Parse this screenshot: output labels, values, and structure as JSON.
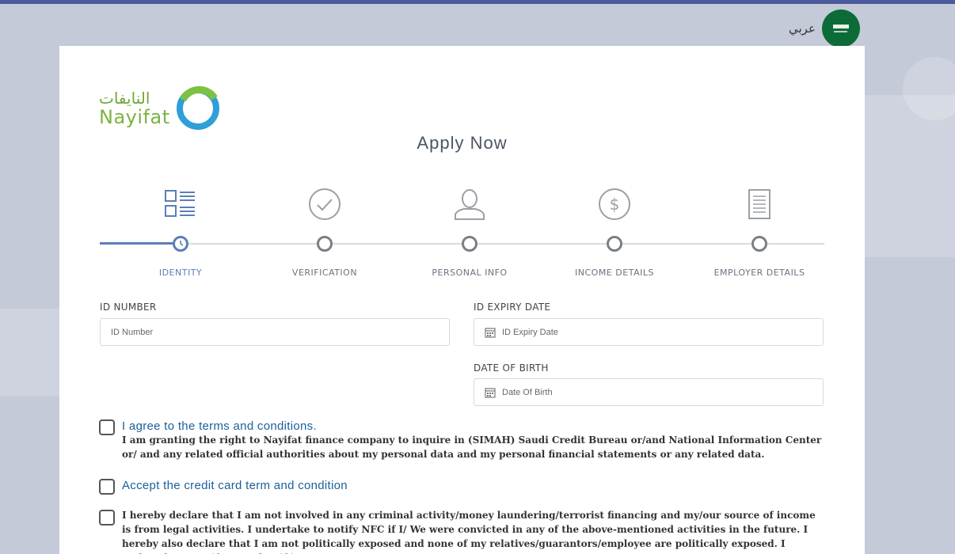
{
  "language_switch": {
    "label": "عربي"
  },
  "logo": {
    "arabic": "النايفات",
    "english": "Nayifat"
  },
  "page": {
    "title": "Apply Now"
  },
  "steps": [
    {
      "label": "IDENTITY",
      "icon": "form-list-icon",
      "active": true
    },
    {
      "label": "VERIFICATION",
      "icon": "check-circle-icon",
      "active": false
    },
    {
      "label": "PERSONAL INFO",
      "icon": "person-icon",
      "active": false
    },
    {
      "label": "INCOME DETAILS",
      "icon": "dollar-circle-icon",
      "active": false
    },
    {
      "label": "EMPLOYER DETAILS",
      "icon": "notepad-icon",
      "active": false
    }
  ],
  "form": {
    "id_number": {
      "label": "ID NUMBER",
      "placeholder": "ID Number"
    },
    "id_expiry": {
      "label": "ID EXPIRY DATE",
      "placeholder": "ID Expiry Date"
    },
    "dob": {
      "label": "DATE OF BIRTH",
      "placeholder": "Date Of Birth"
    }
  },
  "agreements": {
    "terms": {
      "title": "I agree to the terms and conditions.",
      "text": "I am granting the right to Nayifat finance company to inquire in (SIMAH) Saudi Credit Bureau or/and National Information Center or/ and any related official authorities about my personal data and my personal financial statements or any related data."
    },
    "credit_card": {
      "title": "Accept the credit card term and condition"
    },
    "declaration": {
      "text": "I hereby declare that I am not involved in any criminal activity/money laundering/terrorist financing and my/our source of income is from legal activities. I undertake to notify NFC if I/ We were convicted in any of the above-mentioned activities in the future. I hereby also declare that I am not politically exposed and none of my relatives/guarantors/employee are politically exposed. I undertake to notify NFC that if in"
    }
  },
  "colors": {
    "accent": "#5b7fb5",
    "link": "#1c5f9a",
    "brand_green": "#7cb342",
    "flag_green": "#0c6b37"
  }
}
